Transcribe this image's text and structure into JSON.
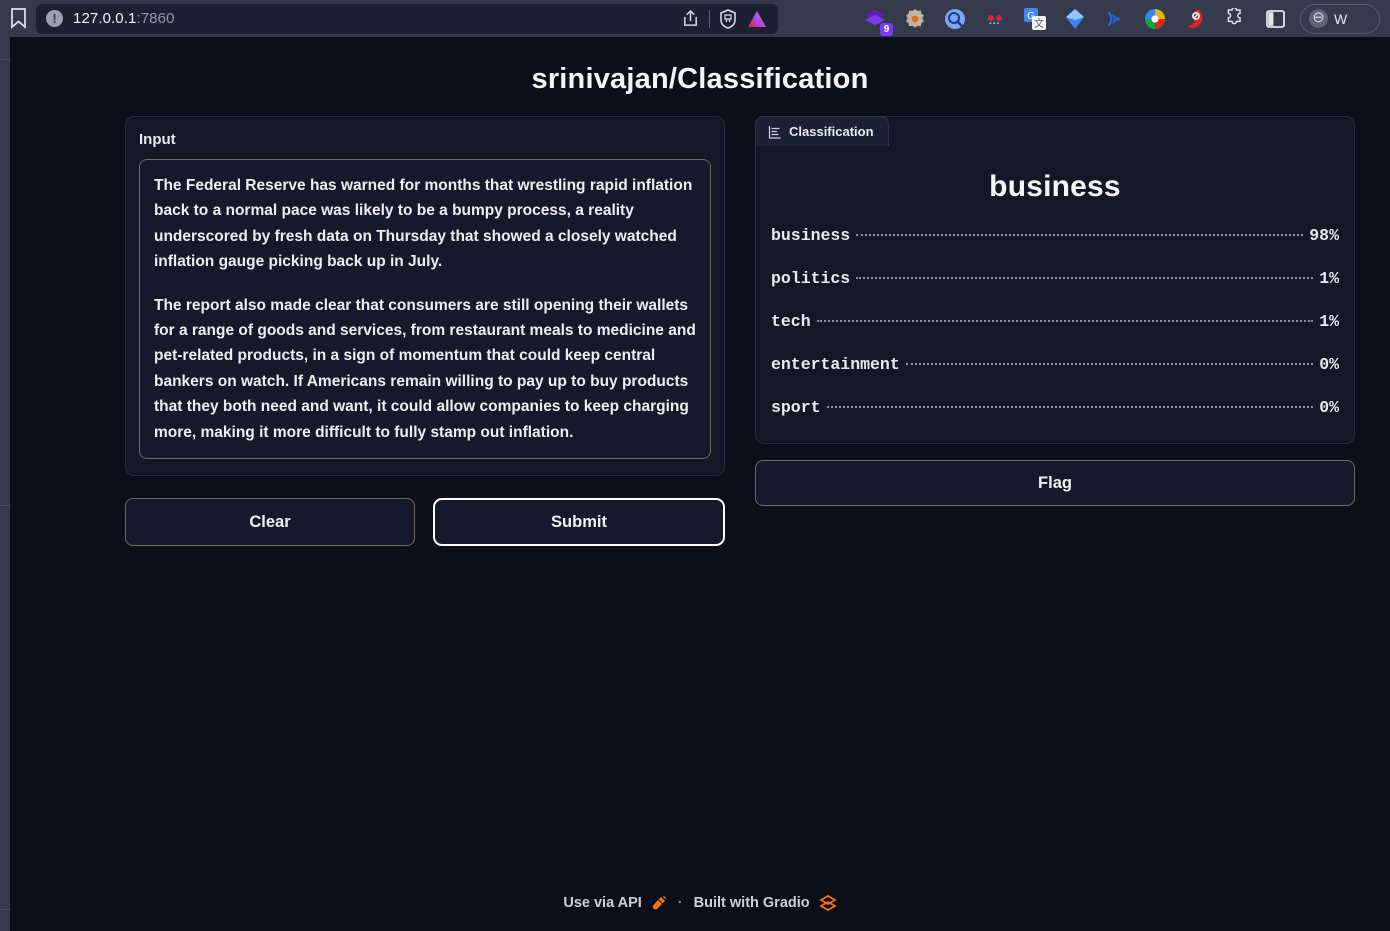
{
  "browser": {
    "bookmark_icon": "bookmark-icon",
    "site_info_icon": "site-info-icon",
    "url_host": "127.0.0.1",
    "url_port": ":7860",
    "share_icon": "share-icon",
    "brave_icon": "brave-shield-icon",
    "profile_icon": "triangle-profile-icon",
    "extensions": [
      {
        "name": "purple-layers-icon",
        "badge": "9"
      },
      {
        "name": "gear-flower-icon",
        "badge": ""
      },
      {
        "name": "magnifier-icon",
        "badge": ""
      },
      {
        "name": "goggles-icon",
        "badge": ""
      },
      {
        "name": "google-translate-icon",
        "badge": ""
      },
      {
        "name": "diamond-icon",
        "badge": ""
      },
      {
        "name": "wifi-signal-icon",
        "badge": ""
      },
      {
        "name": "colorful-swirl-icon",
        "badge": ""
      },
      {
        "name": "red-block-icon",
        "badge": ""
      },
      {
        "name": "puzzle-piece-icon",
        "badge": ""
      },
      {
        "name": "sidebar-toggle-icon",
        "badge": ""
      }
    ],
    "profile_label": "W"
  },
  "app": {
    "title": "srinivajan/Classification"
  },
  "input_block": {
    "label": "Input",
    "paragraphs": [
      "The Federal Reserve has warned for months that wrestling rapid inflation back to a normal pace was likely to be a bumpy process, a reality underscored by fresh data on Thursday that showed a closely watched inflation gauge picking back up in July.",
      "The report also made clear that consumers are still opening their wallets for a range of goods and services, from restaurant meals to medicine and pet-related products, in a sign of momentum that could keep central bankers on watch. If Americans remain willing to pay up to buy products that they both need and want, it could allow companies to keep charging more, making it more difficult to fully stamp out inflation."
    ],
    "placeholder": "",
    "clear_label": "Clear",
    "submit_label": "Submit"
  },
  "output_block": {
    "tab_label": "Classification",
    "tab_icon": "bar-chart-icon",
    "top_label": "business",
    "flag_label": "Flag"
  },
  "chart_data": {
    "type": "bar",
    "title": "Classification",
    "categories": [
      "business",
      "politics",
      "tech",
      "entertainment",
      "sport"
    ],
    "values": [
      98,
      1,
      1,
      0,
      0
    ],
    "value_labels": [
      "98%",
      "1%",
      "1%",
      "0%",
      "0%"
    ],
    "xlabel": "",
    "ylabel": "",
    "ylim": [
      0,
      100
    ],
    "unit": "percent",
    "predicted_label": "business",
    "legend": "none",
    "grid": false
  },
  "footer": {
    "api_label": "Use via API",
    "api_icon": "plug-icon",
    "separator": "·",
    "built_label": "Built with Gradio",
    "gradio_icon": "gradio-logo-icon"
  },
  "colors": {
    "page_bg": "#0b0f19",
    "panel_bg": "#131827",
    "border": "#6e6a5f",
    "accent": "#f97316",
    "text": "#edeef2"
  }
}
